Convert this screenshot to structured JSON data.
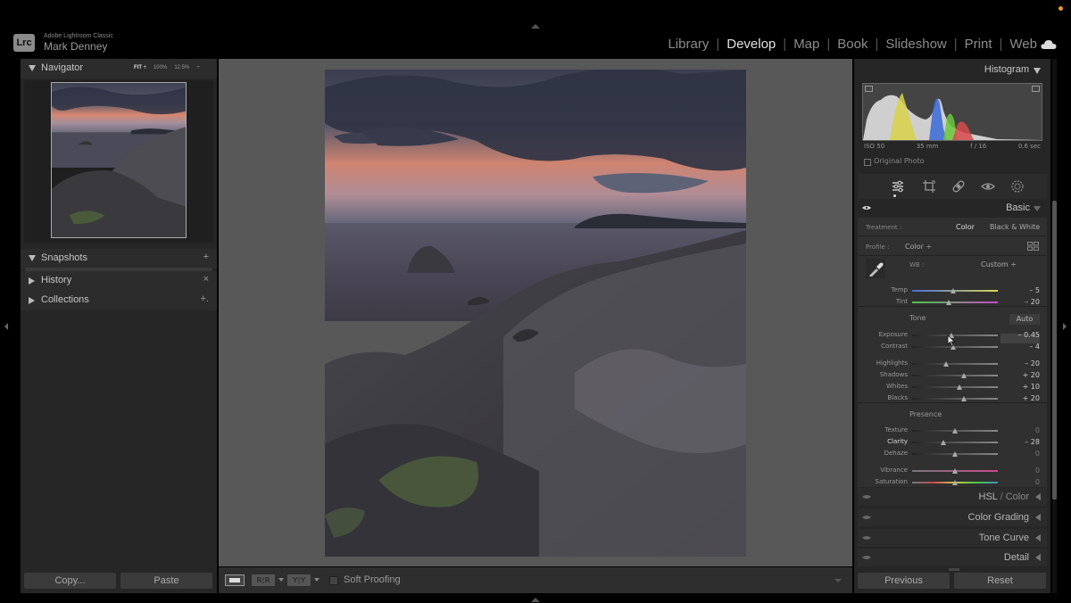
{
  "app": {
    "logo": "Lrc",
    "name": "Adobe Lightroom Classic",
    "user": "Mark Denney"
  },
  "modules": [
    {
      "label": "Library",
      "active": false
    },
    {
      "label": "Develop",
      "active": true
    },
    {
      "label": "Map",
      "active": false
    },
    {
      "label": "Book",
      "active": false
    },
    {
      "label": "Slideshow",
      "active": false
    },
    {
      "label": "Print",
      "active": false
    },
    {
      "label": "Web",
      "active": false
    }
  ],
  "module_separator": "|",
  "left_panel": {
    "navigator": {
      "title": "Navigator",
      "zoom_options": [
        "FIT ÷",
        "100%",
        "12.5%",
        "÷"
      ]
    },
    "snapshots": {
      "title": "Snapshots",
      "action": "+"
    },
    "history": {
      "title": "History",
      "action": "×"
    },
    "collections": {
      "title": "Collections",
      "action": "+."
    },
    "copy_label": "Copy...",
    "paste_label": "Paste"
  },
  "toolbar": {
    "before_after_label": "R|R",
    "before_after_lr_label": "Y|Y",
    "soft_proofing_label": "Soft Proofing"
  },
  "right_panel": {
    "histogram": {
      "title": "Histogram",
      "iso": "ISO 50",
      "focal": "35 mm",
      "aperture": "f / 16",
      "shutter": "0.6 sec",
      "original_photo_label": "Original Photo"
    },
    "tools": [
      "sliders-icon",
      "crop-icon",
      "healing-icon",
      "red-eye-icon",
      "masking-icon"
    ],
    "basic": {
      "title": "Basic",
      "treatment_label": "Treatment :",
      "treatment_color": "Color",
      "treatment_bw": "Black & White",
      "profile_label": "Profile :",
      "profile_value": "Color ÷",
      "wb_label": "WB :",
      "wb_value": "Custom ÷",
      "tone_label": "Tone",
      "auto_label": "Auto",
      "presence_label": "Presence",
      "sliders": [
        {
          "label": "Temp",
          "value": "– 5",
          "position": 0.48,
          "track": "temp"
        },
        {
          "label": "Tint",
          "value": "– 20",
          "position": 0.43,
          "track": "tint"
        },
        {
          "label": "Exposure",
          "value": "– 0.45",
          "position": 0.46,
          "track": "gray"
        },
        {
          "label": "Contrast",
          "value": "– 4",
          "position": 0.48,
          "track": "gray"
        },
        {
          "label": "Highlights",
          "value": "– 20",
          "position": 0.4,
          "track": "gray"
        },
        {
          "label": "Shadows",
          "value": "+ 20",
          "position": 0.6,
          "track": "gray"
        },
        {
          "label": "Whites",
          "value": "+ 10",
          "position": 0.55,
          "track": "gray"
        },
        {
          "label": "Blacks",
          "value": "+ 20",
          "position": 0.6,
          "track": "gray"
        },
        {
          "label": "Texture",
          "value": "0",
          "position": 0.5,
          "track": "gray"
        },
        {
          "label": "Clarity",
          "value": "– 28",
          "position": 0.36,
          "track": "gray",
          "active": true
        },
        {
          "label": "Dehaze",
          "value": "0",
          "position": 0.5,
          "track": "gray"
        },
        {
          "label": "Vibrance",
          "value": "0",
          "position": 0.5,
          "track": "vib"
        },
        {
          "label": "Saturation",
          "value": "0",
          "position": 0.5,
          "track": "sat"
        }
      ]
    },
    "panels": {
      "hsl": "HSL",
      "hsl_slash": "/",
      "hsl_color": "Color",
      "color_grading": "Color Grading",
      "tone_curve": "Tone Curve",
      "detail": "Detail"
    },
    "previous_label": "Previous",
    "reset_label": "Reset"
  },
  "colors": {
    "accent_active": "#e2e2e2",
    "panel_bg": "#262626",
    "canvas_bg": "#585858"
  }
}
